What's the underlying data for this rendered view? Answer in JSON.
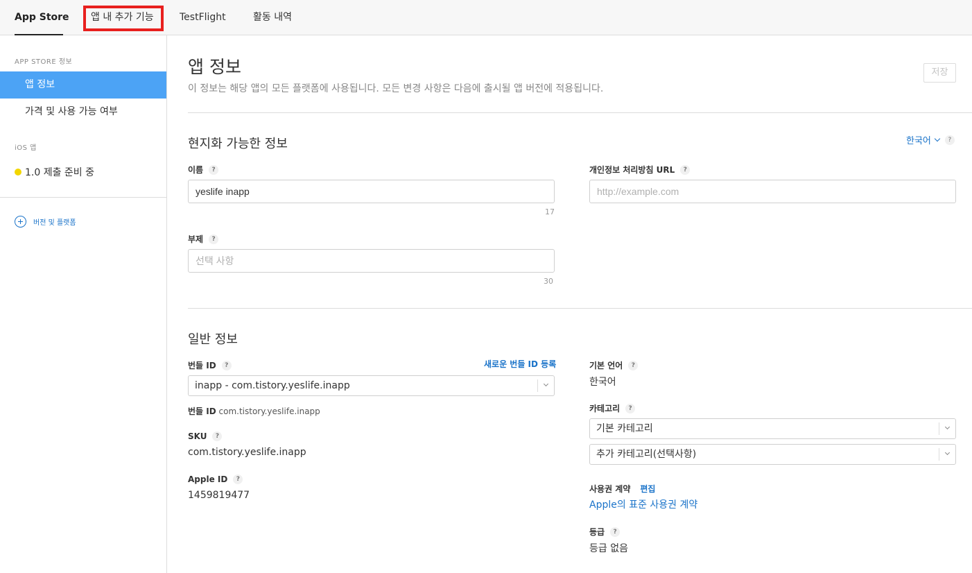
{
  "topnav": {
    "tabs": [
      {
        "label": "App Store",
        "active": true
      },
      {
        "label": "앱 내 추가 기능",
        "highlighted": true
      },
      {
        "label": "TestFlight"
      },
      {
        "label": "활동 내역"
      }
    ],
    "highlight_color": "#e8201e"
  },
  "sidebar": {
    "section1_heading": "APP STORE 정보",
    "items": [
      {
        "label": "앱 정보",
        "selected": true
      },
      {
        "label": "가격 및 사용 가능 여부"
      }
    ],
    "section2_heading": "iOS 앱",
    "version_status": "1.0 제출 준비 중",
    "status_color": "#f2d600",
    "add_label": "버전 및 플랫폼",
    "selected_color": "#4ca3f5"
  },
  "main": {
    "title": "앱 정보",
    "subtitle": "이 정보는 해당 앱의 모든 플랫폼에 사용됩니다. 모든 변경 사항은 다음에 출시될 앱 버전에 적용됩니다.",
    "save_label": "저장",
    "localizable": {
      "heading": "현지화 가능한 정보",
      "language": "한국어",
      "name_label": "이름",
      "name_value": "yeslife inapp",
      "name_counter": "17",
      "subtitle_label": "부제",
      "subtitle_placeholder": "선택 사항",
      "subtitle_counter": "30",
      "privacy_label": "개인정보 처리방침 URL",
      "privacy_placeholder": "http://example.com"
    },
    "general": {
      "heading": "일반 정보",
      "bundle_id_label": "번들 ID",
      "register_bundle_link": "새로운 번들 ID 등록",
      "bundle_select_value": "inapp - com.tistory.yeslife.inapp",
      "bundle_id_caption_label": "번들 ID",
      "bundle_id_caption_value": "com.tistory.yeslife.inapp",
      "sku_label": "SKU",
      "sku_value": "com.tistory.yeslife.inapp",
      "apple_id_label": "Apple ID",
      "apple_id_value": "1459819477",
      "primary_language_label": "기본 언어",
      "primary_language_value": "한국어",
      "category_label": "카테고리",
      "primary_category": "기본 카테고리",
      "secondary_category": "추가 카테고리(선택사항)",
      "license_label": "사용권 계약",
      "license_edit": "편집",
      "license_link": "Apple의 표준 사용권 계약",
      "rating_label": "등급",
      "rating_value": "등급 없음"
    },
    "help_glyph": "?",
    "accent_color": "#1a73c9"
  }
}
